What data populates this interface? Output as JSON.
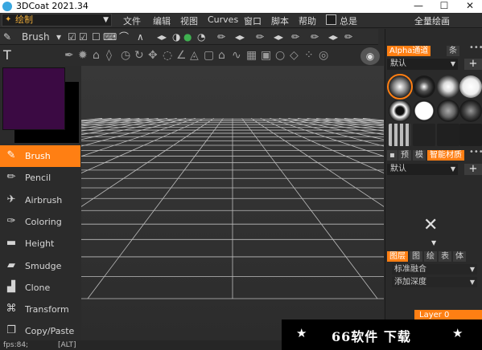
{
  "titlebar": {
    "title": "3DCoat 2021.34",
    "minimize": "—",
    "maximize": "☐",
    "close": "✕"
  },
  "menubar": {
    "room": "绘制",
    "items": [
      "文件",
      "编辑",
      "视图",
      "Curves",
      "窗口",
      "脚本",
      "帮助"
    ],
    "checkbox_label": "总是",
    "right_text": "全量绘画"
  },
  "optbar": {
    "tool_name": "Brush"
  },
  "tools": [
    {
      "label": "Brush",
      "icon": "brush-icon",
      "active": true
    },
    {
      "label": "Pencil",
      "icon": "pencil-icon"
    },
    {
      "label": "Airbrush",
      "icon": "airbrush-icon"
    },
    {
      "label": "Coloring",
      "icon": "coloring-icon"
    },
    {
      "label": "Height",
      "icon": "height-icon"
    },
    {
      "label": "Smudge",
      "icon": "smudge-icon"
    },
    {
      "label": "Clone",
      "icon": "clone-icon"
    },
    {
      "label": "Transform",
      "icon": "transform-icon"
    },
    {
      "label": "Copy/Paste",
      "icon": "copy-paste-icon"
    }
  ],
  "colors": {
    "primary": "#3b0a43",
    "secondary": "#000000",
    "accent": "#ff7f13"
  },
  "right_panel": {
    "alpha_tabs": [
      "Alpha通道",
      "条"
    ],
    "alpha_preset": "默认",
    "material_tabs": [
      "预",
      "模",
      "智能材质"
    ],
    "material_preset": "默认",
    "layer_tabs": [
      "图层",
      "图",
      "绘",
      "表",
      "体"
    ],
    "blend_mode": "标准融合",
    "depth_mode": "添加深度",
    "layer_button": "Layer 0"
  },
  "status": {
    "fps": "fps:84;",
    "key": "[ALT]"
  },
  "watermark": {
    "text": "66软件 下载",
    "star": "★"
  }
}
